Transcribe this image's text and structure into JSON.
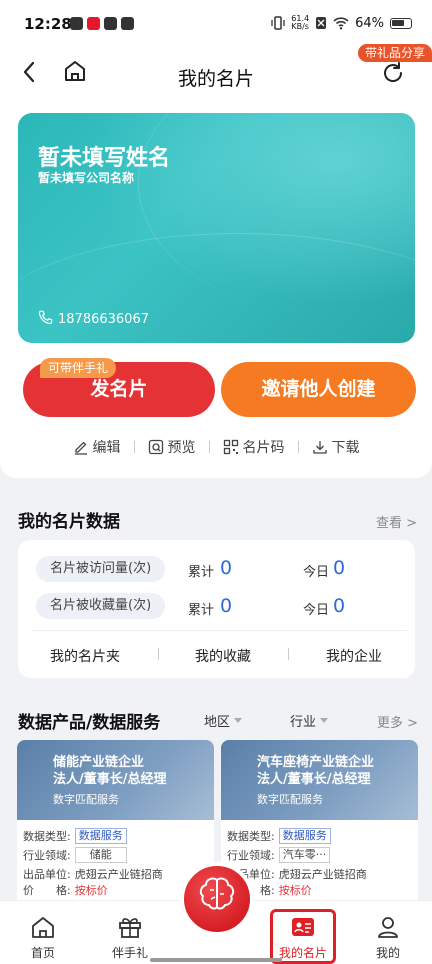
{
  "status_bar": {
    "time": "12:28",
    "net_speed_value": "61.4",
    "net_speed_unit": "KB/s",
    "battery": "64%"
  },
  "nav": {
    "title": "我的名片",
    "share_badge": "带礼品分享"
  },
  "card": {
    "name": "暂未填写姓名",
    "company": "暂未填写公司名称",
    "phone": "18786636067"
  },
  "buttons": {
    "send": "发名片",
    "send_tag": "可带伴手礼",
    "invite": "邀请他人创建"
  },
  "actions": [
    {
      "label": "编辑",
      "icon": "edit-icon"
    },
    {
      "label": "预览",
      "icon": "preview-icon"
    },
    {
      "label": "名片码",
      "icon": "qrcode-icon"
    },
    {
      "label": "下载",
      "icon": "download-icon"
    }
  ],
  "data_section": {
    "title": "我的名片数据",
    "more": "查看 >",
    "stats": [
      {
        "label": "名片被访问量(次)",
        "total_label": "累计",
        "total": "0",
        "today_label": "今日",
        "today": "0"
      },
      {
        "label": "名片被收藏量(次)",
        "total_label": "累计",
        "total": "0",
        "today_label": "今日",
        "today": "0"
      }
    ],
    "links": [
      "我的名片夹",
      "我的收藏",
      "我的企业"
    ]
  },
  "products_section": {
    "title": "数据产品/数据服务",
    "filters": [
      "地区",
      "行业"
    ],
    "more": "更多 >",
    "items": [
      {
        "title_line1": "储能产业链企业",
        "title_line2": "法人/董事长/总经理",
        "subtitle": "数字匹配服务",
        "type_label": "数据类型:",
        "type": "数据服务",
        "industry_label": "行业领域:",
        "industry": "储能",
        "unit_label": "出品单位:",
        "unit": "虎翅云产业链招商",
        "price_label": "价　　格:",
        "price": "按标价"
      },
      {
        "title_line1": "汽车座椅产业链企业",
        "title_line2": "法人/董事长/总经理",
        "subtitle": "数字匹配服务",
        "type_label": "数据类型:",
        "type": "数据服务",
        "industry_label": "行业领域:",
        "industry": "汽车零···",
        "unit_label": "出品单位:",
        "unit": "虎翅云产业链招商",
        "price_label": "价　　格:",
        "price": "按标价"
      }
    ]
  },
  "bottom_nav": {
    "home": "首页",
    "gift": "伴手礼",
    "center": "推广大脑",
    "card": "我的名片",
    "me": "我的"
  },
  "colors": {
    "red": "#e53235",
    "orange": "#f57a22",
    "teal": "#2bb7b9",
    "blue_value": "#2f6bd8"
  }
}
